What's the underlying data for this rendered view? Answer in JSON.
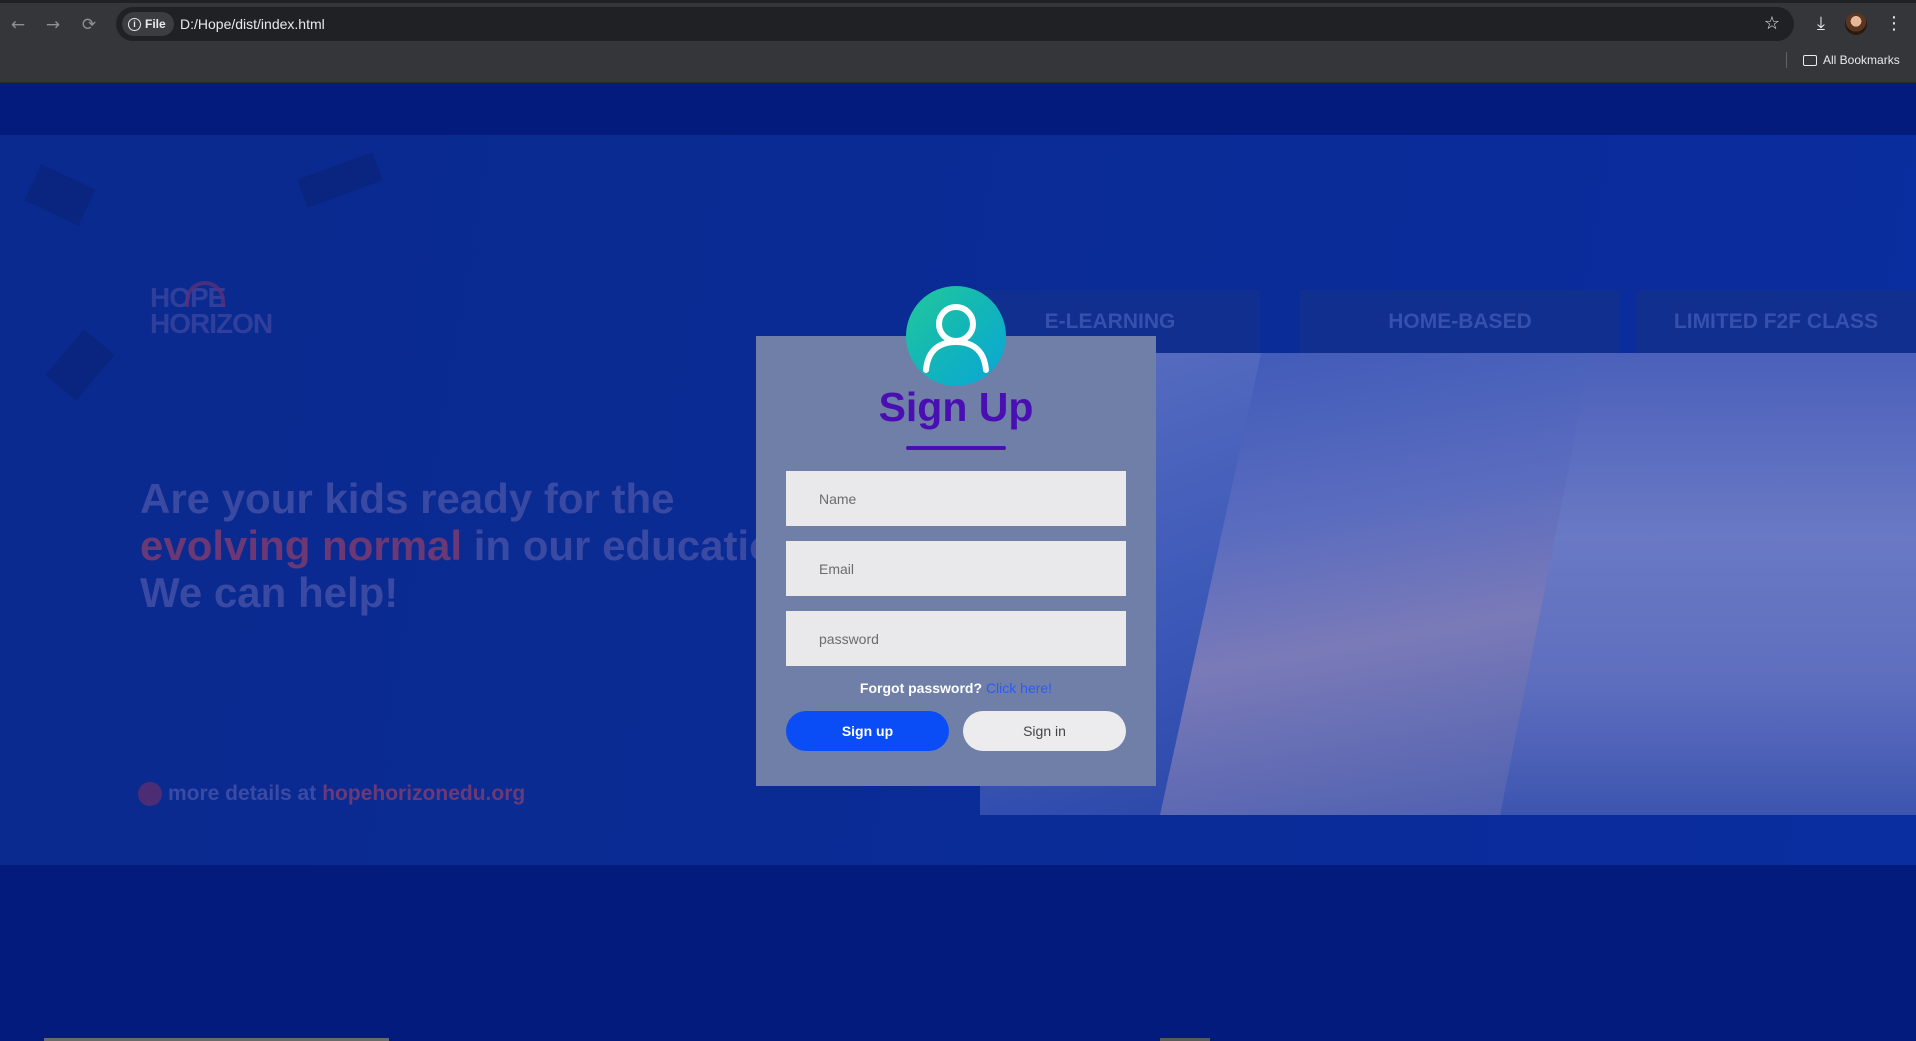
{
  "browser": {
    "site_chip": "File",
    "url": "D:/Hope/dist/index.html",
    "bookmarks_label": "All Bookmarks"
  },
  "banner": {
    "logo_line1": "HOPE",
    "logo_line2": "HORIZON",
    "tabs": [
      "E-LEARNING",
      "HOME-BASED",
      "LIMITED F2F CLASS"
    ],
    "headline_line1": "Are your kids ready for the",
    "headline_line2_highlight": "evolving normal",
    "headline_line2_rest": " in our educatio",
    "headline_line3": "We can help!",
    "details_prefix": "more details at ",
    "details_site": "hopehorizonedu.org"
  },
  "form": {
    "title": "Sign Up",
    "name_placeholder": "Name",
    "email_placeholder": "Email",
    "password_placeholder": "password",
    "forgot_text": "Forgot password?",
    "forgot_link": "Click here!",
    "signup_label": "Sign up",
    "signin_label": "Sign in"
  },
  "icons": {
    "back": "arrow-left",
    "forward": "arrow-right",
    "reload": "reload",
    "bookmark": "star",
    "download": "download",
    "menu": "kebab-menu",
    "user": "user-circle"
  },
  "colors": {
    "page_bg": "#031b7d",
    "title": "#4a0fb2",
    "primary_button": "#0a4cf5",
    "avatar_gradient": [
      "#22c89a",
      "#0aa5d8"
    ]
  }
}
